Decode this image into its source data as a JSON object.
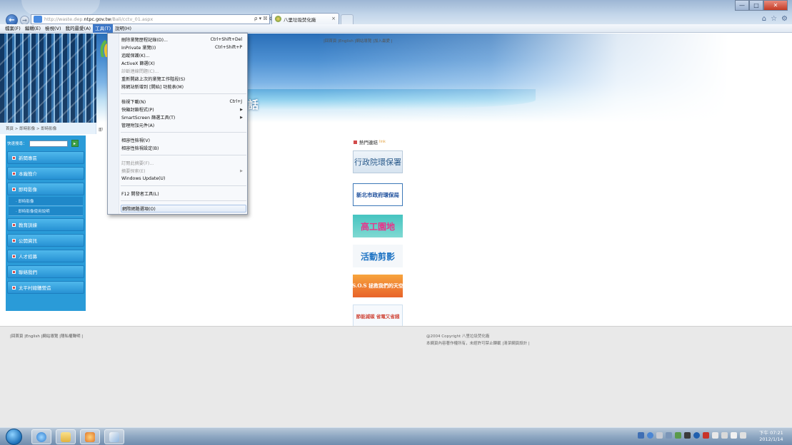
{
  "browser": {
    "address_prefix": "http://waste.dep.",
    "address_domain": "ntpc.gov.tw",
    "address_suffix": "/Bali/cctv_01.aspx",
    "address_controls": "ρ ▾ ☒ ¢ ✕",
    "tab_label": "八里垃圾焚化廠",
    "tab_close": "×"
  },
  "window_controls": {
    "min": "—",
    "max": "□",
    "close": "✕"
  },
  "menubar": {
    "items": [
      "檔案(F)",
      "編輯(E)",
      "檢視(V)",
      "我的最愛(A)",
      "工具(T)",
      "說明(H)"
    ],
    "active_index": 4
  },
  "tools_menu": {
    "items": [
      {
        "label": "刪除瀏覽歷程記錄(D)...",
        "shortcut": "Ctrl+Shift+Del"
      },
      {
        "label": "InPrivate 瀏覽(I)",
        "shortcut": "Ctrl+Shift+P"
      },
      {
        "label": "追蹤保護(K)...",
        "shortcut": ""
      },
      {
        "label": "ActiveX 篩選(X)",
        "shortcut": ""
      },
      {
        "label": "診斷連線問題(C)...",
        "shortcut": "",
        "disabled": true
      },
      {
        "label": "重新開啟上次的瀏覽工作階段(S)",
        "shortcut": ""
      },
      {
        "label": "將網站新增到 [開始] 功能表(M)",
        "shortcut": ""
      },
      {
        "label": "檢視下載(N)",
        "shortcut": "Ctrl+J"
      },
      {
        "label": "快顯封鎖程式(P)",
        "shortcut": "",
        "submenu": true
      },
      {
        "label": "SmartScreen 篩選工具(T)",
        "shortcut": "",
        "submenu": true
      },
      {
        "label": "管理附加元件(A)",
        "shortcut": ""
      },
      {
        "label": "相容性檢視(V)",
        "shortcut": ""
      },
      {
        "label": "相容性檢視設定(B)",
        "shortcut": ""
      },
      {
        "label": "訂閱此摘要(F)...",
        "shortcut": "",
        "disabled": true
      },
      {
        "label": "摘要探索(E)",
        "shortcut": "",
        "disabled": true,
        "submenu": true
      },
      {
        "label": "Windows Update(U)",
        "shortcut": ""
      },
      {
        "label": "F12 開發者工具(L)",
        "shortcut": ""
      },
      {
        "label": "網際網路選項(O)",
        "shortcut": "",
        "highlighted": true
      }
    ]
  },
  "page": {
    "top_links": "|回首頁 |English |網站導覽 |加入最愛 |",
    "banner_slogan": "話",
    "breadcrumb": "首頁 > 即時影像 > 即時影像",
    "content_title": "即",
    "quick_search_label": "快速搜尋：",
    "sidebar": {
      "items": [
        {
          "label": "新聞專區"
        },
        {
          "label": "本廠簡介"
        },
        {
          "label": "即時影像"
        },
        {
          "label": "教育訓練"
        },
        {
          "label": "公開資訊"
        },
        {
          "label": "人才招募"
        },
        {
          "label": "聯絡我們"
        },
        {
          "label": "太平村總體營造"
        }
      ],
      "subitems": [
        {
          "label": "· 即時影像"
        },
        {
          "label": "· 即時影像使用說明"
        }
      ]
    },
    "hot_links_title": "熱門連結",
    "hot_links_en": "link",
    "link_banners": [
      {
        "label": "行政院環保署"
      },
      {
        "label": "新北市政府環保局"
      },
      {
        "label": "高工園地"
      },
      {
        "label": "活動剪影"
      },
      {
        "label": "S.O.S 拯救我們的天空"
      },
      {
        "label": "節能減碳 省電又省錢"
      }
    ],
    "footer_links": "|回首頁 |English |網站導覽 |隱私權聲明 |",
    "footer_copyright": "@2004 Copyright 八里垃圾焚化廠",
    "footer_notice": "本網頁內容著作權所有，未經許可禁止轉載 |清潔網頁設計 |"
  },
  "taskbar": {
    "clock_time": "下午 07:21",
    "clock_date": "2012/1/14"
  }
}
